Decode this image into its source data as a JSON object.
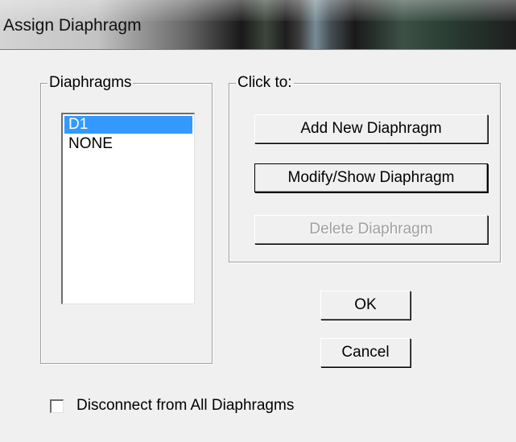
{
  "window": {
    "title": "Assign Diaphragm"
  },
  "diaphragms_group": {
    "label": "Diaphragms",
    "items": [
      {
        "label": "D1",
        "selected": true
      },
      {
        "label": "NONE",
        "selected": false
      }
    ]
  },
  "click_to_group": {
    "label": "Click to:",
    "add_button": "Add New Diaphragm",
    "modify_button": "Modify/Show Diaphragm",
    "delete_button": "Delete Diaphragm",
    "delete_enabled": false
  },
  "buttons": {
    "ok": "OK",
    "cancel": "Cancel"
  },
  "disconnect_checkbox": {
    "label": "Disconnect from All Diaphragms",
    "checked": false
  },
  "colors": {
    "selection": "#3399ff",
    "dialog_bg": "#f0f0f0",
    "disabled_text": "#a0a0a0"
  }
}
